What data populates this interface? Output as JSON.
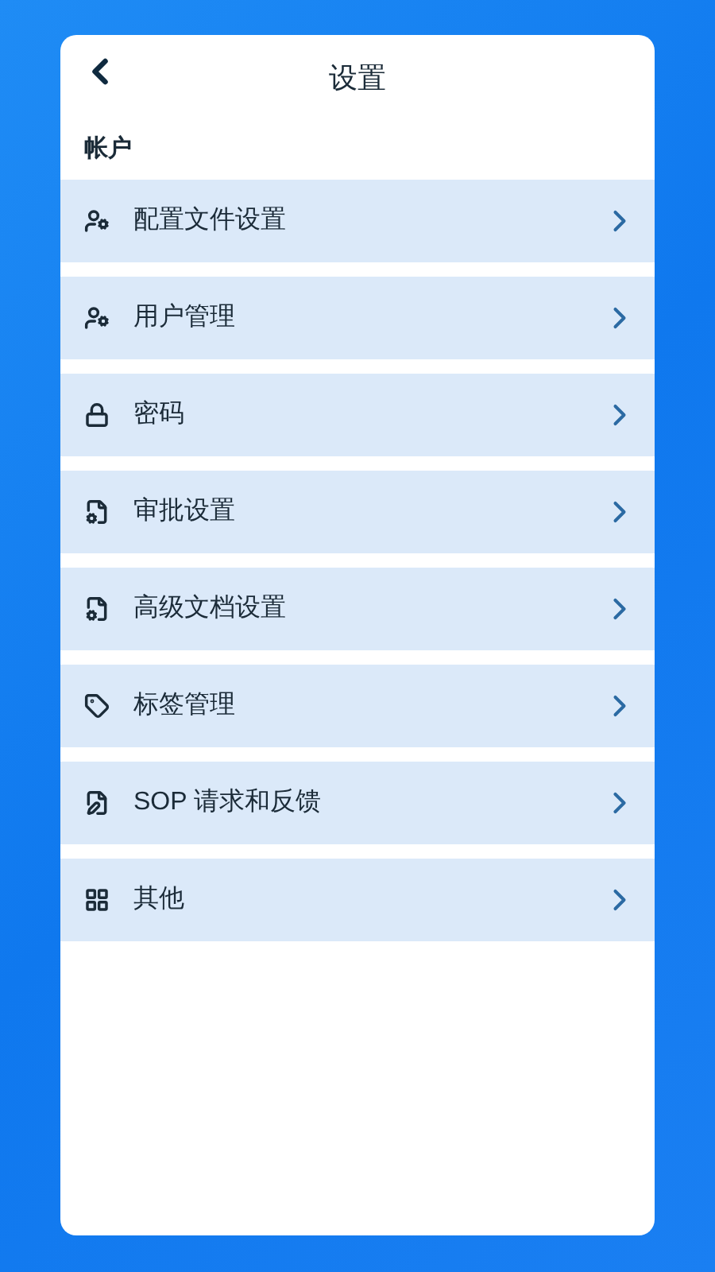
{
  "header": {
    "title": "设置"
  },
  "section": {
    "title": "帐户"
  },
  "items": [
    {
      "label": "配置文件设置",
      "kind": "user-gear"
    },
    {
      "label": "用户管理",
      "kind": "user-gear"
    },
    {
      "label": "密码",
      "kind": "lock"
    },
    {
      "label": "审批设置",
      "kind": "file-gear"
    },
    {
      "label": "高级文档设置",
      "kind": "file-gear"
    },
    {
      "label": "标签管理",
      "kind": "tag"
    },
    {
      "label": "SOP 请求和反馈",
      "kind": "file-edit"
    },
    {
      "label": "其他",
      "kind": "grid-plus"
    }
  ]
}
